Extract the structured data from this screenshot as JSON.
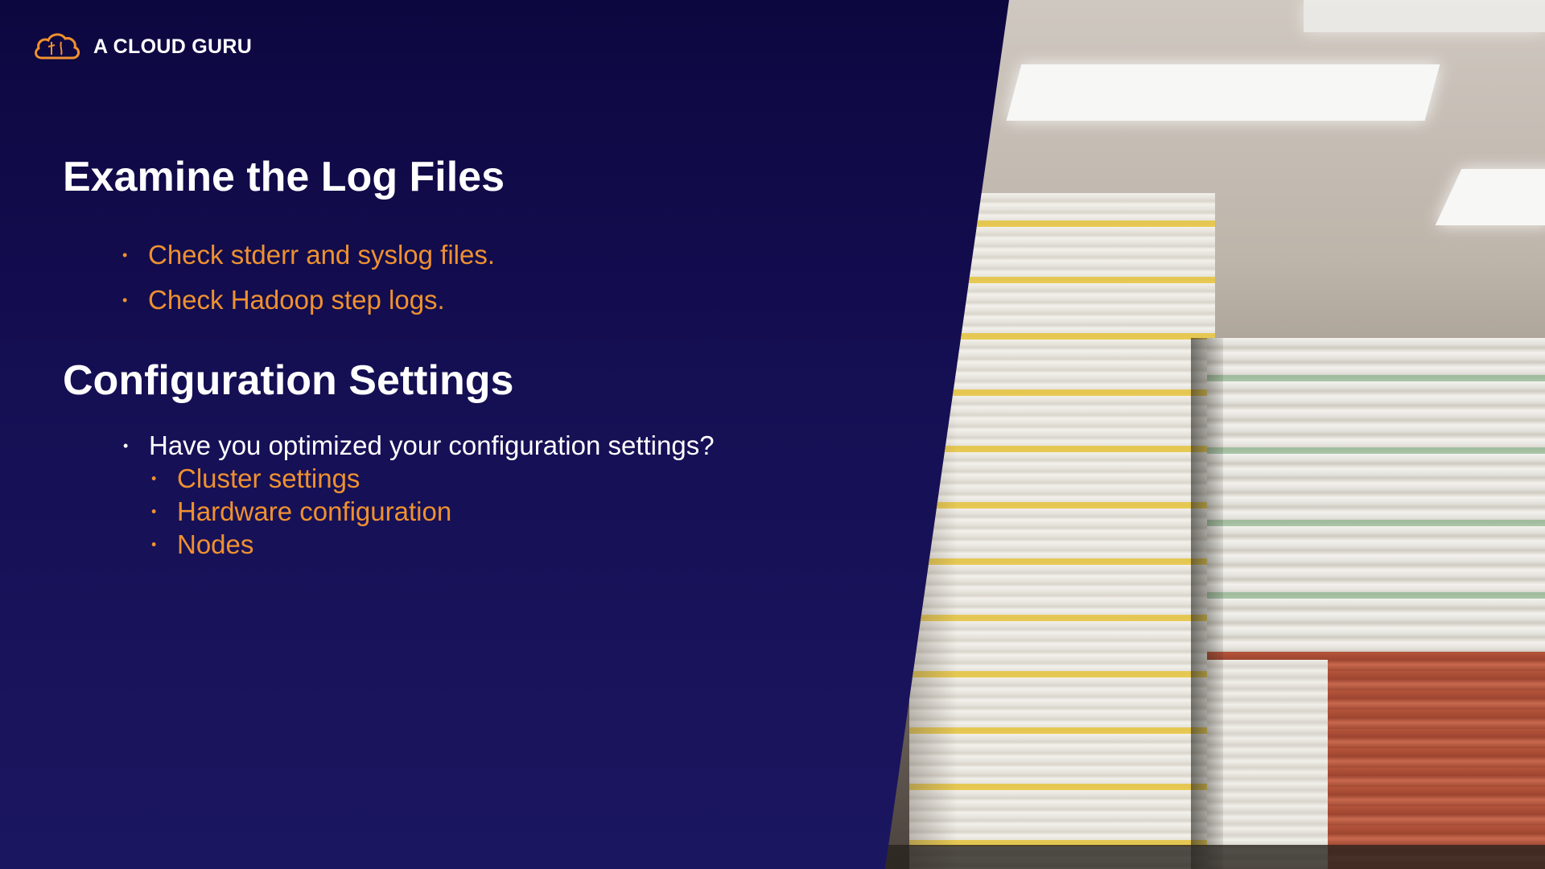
{
  "brand": {
    "name": "A CLOUD GURU",
    "logo_icon": "cloud-logo-icon",
    "accent": "#ef9130"
  },
  "section1": {
    "title": "Examine the Log Files",
    "bullets": [
      "Check stderr and syslog files.",
      "Check Hadoop step logs."
    ]
  },
  "section2": {
    "title": "Configuration Settings",
    "bullet": "Have you optimized your configuration settings?",
    "subbullets": [
      "Cluster settings",
      "Hardware configuration",
      "Nodes"
    ]
  },
  "colors": {
    "background": "#150f54",
    "heading": "#ffffff",
    "accent": "#ef9130"
  }
}
